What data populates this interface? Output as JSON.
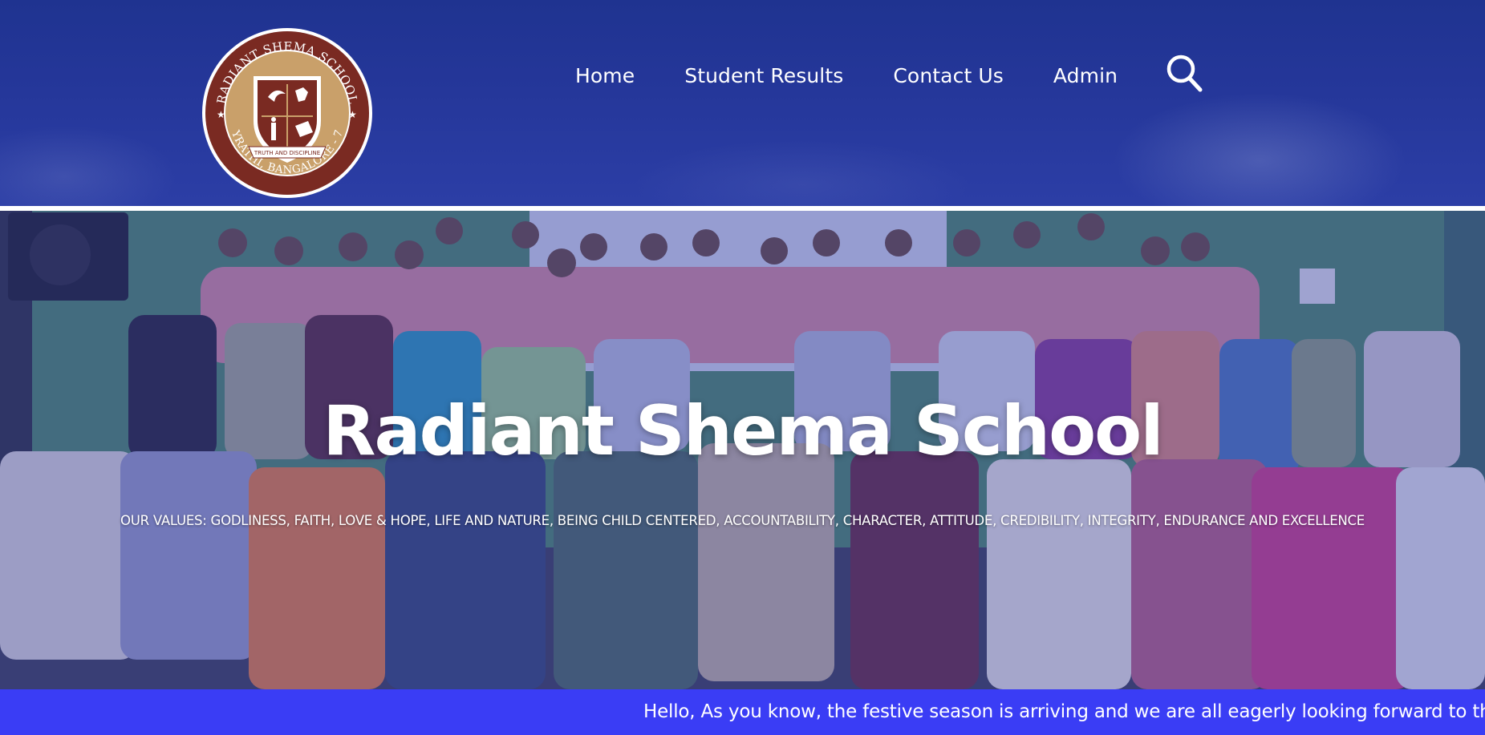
{
  "school": {
    "logo_ring_text": "RADIANT SHEMA SCHOOL",
    "logo_bottom_text": "BYRATHI, BANGALORE - 77",
    "logo_motto": "TRUTH AND DISCIPLINE"
  },
  "nav": {
    "items": [
      {
        "label": "Home"
      },
      {
        "label": "Student Results"
      },
      {
        "label": "Contact Us"
      },
      {
        "label": "Admin"
      }
    ],
    "search_icon": "search-icon"
  },
  "hero": {
    "title": "Radiant Shema School",
    "values": "OUR VALUES: GODLINESS, FAITH, LOVE & HOPE, LIFE AND NATURE, BEING CHILD CENTERED, ACCOUNTABILITY, CHARACTER, ATTITUDE, CREDIBILITY, INTEGRITY, ENDURANCE AND EXCELLENCE"
  },
  "ticker": {
    "text": "Hello, As you know, the festive season is arriving and we are all eagerly looking forward to the"
  },
  "colors": {
    "header_bg": "#25379a",
    "ticker_bg": "#3a3df5",
    "logo_brown": "#7a2a22",
    "logo_tan": "#c9a06a"
  }
}
